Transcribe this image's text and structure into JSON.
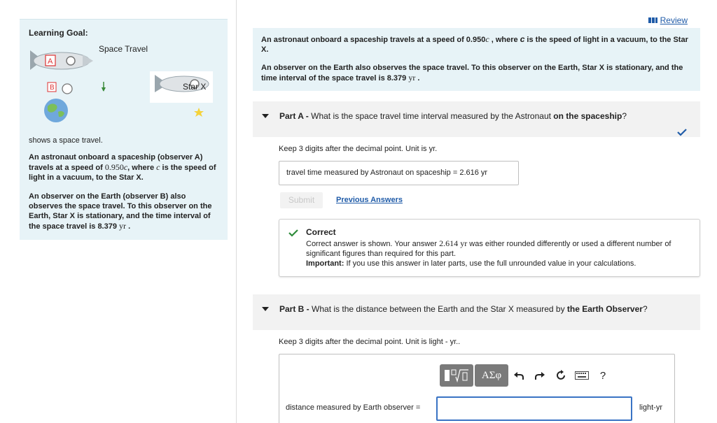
{
  "left": {
    "learning_goal_title": "Learning Goal:",
    "figure": {
      "space_travel_label": "Space Travel",
      "star_label": "Star X",
      "marker_a": "A",
      "marker_b": "B",
      "velocity_label": "v"
    },
    "shows_text": "shows a space travel.",
    "para1_before": "An astronaut onboard a spaceship (observer A) travels at a speed of ",
    "para1_speed": "0.950",
    "para1_c1": "c",
    "para1_mid": ", where ",
    "para1_c2": "c",
    "para1_after": " is the speed of light in a vacuum, to the Star X.",
    "para2_before": "An observer on the Earth (observer B) also observes the space travel. To this observer on the Earth, Star X is stationary, and the time interval of the space travel is 8.379 ",
    "para2_unit": "yr",
    "para2_after": " ."
  },
  "header": {
    "review_label": "Review"
  },
  "problem": {
    "p1_before": "An astronaut onboard a spaceship travels at a speed of 0.950",
    "p1_c1": "c",
    "p1_mid": " , where ",
    "p1_c2": "c",
    "p1_after": " is the speed of light in a vacuum, to the Star X.",
    "p2_before": "An observer on the Earth also observes the space travel. To this observer on the Earth, Star X is stationary, and the time interval of the space travel is 8.379 ",
    "p2_unit": "yr",
    "p2_after": " ."
  },
  "part_a": {
    "label": "Part A -",
    "question_before": " What is the space travel time interval measured by the Astronaut ",
    "question_bold": "on the spaceship",
    "question_after": "?",
    "instruction": "Keep 3 digits after the decimal point. Unit is yr.",
    "answer_label": "travel time measured by Astronaut on spaceship = ",
    "answer_value": "2.616",
    "answer_unit": "yr",
    "submit_label": "Submit",
    "previous_answers_label": "Previous Answers",
    "feedback": {
      "title": "Correct",
      "line1_before": "Correct answer is shown. Your answer ",
      "line1_value": "2.614",
      "line1_unit": "yr",
      "line1_after": " was either rounded differently or used a different number of significant figures than required for this part.",
      "important_label": "Important:",
      "important_text": " If you use this answer in later parts, use the full unrounded value in your calculations."
    }
  },
  "part_b": {
    "label": "Part B -",
    "question_before": " What is the distance between the Earth and the Star X measured by ",
    "question_bold": "the Earth Observer",
    "question_after": "?",
    "instruction": "Keep 3 digits after the decimal point. Unit is light - yr..",
    "toolbar": {
      "greek_label": "ΑΣφ",
      "help_label": "?"
    },
    "answer_label": "distance measured by Earth observer =",
    "answer_value": "",
    "answer_unit": "light-yr"
  },
  "colors": {
    "accent_blue": "#1f5ba8",
    "correct_green": "#2e8b3a",
    "panel_bg": "#e7f3f7"
  }
}
